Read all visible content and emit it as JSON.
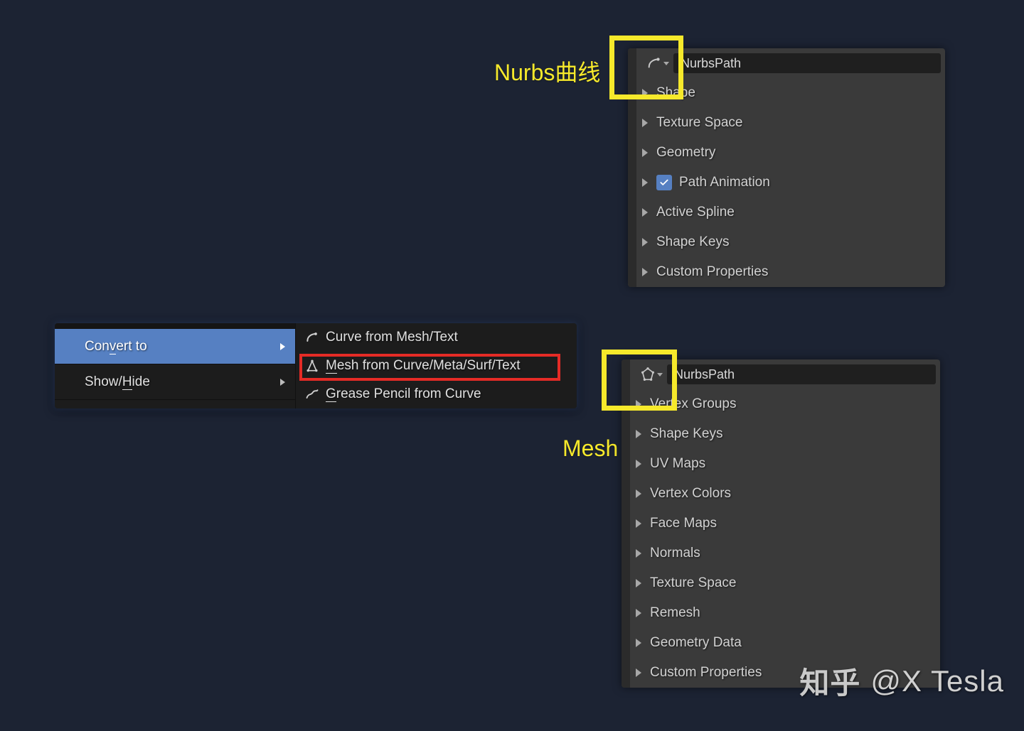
{
  "annotations": {
    "nurbs_label": "Nurbs曲线",
    "mesh_label": "Mesh"
  },
  "panel_curve": {
    "name": "NurbsPath",
    "rows": [
      "Shape",
      "Texture Space",
      "Geometry",
      "Path Animation",
      "Active Spline",
      "Shape Keys",
      "Custom Properties"
    ]
  },
  "panel_mesh": {
    "name": "NurbsPath",
    "rows": [
      "Vertex Groups",
      "Shape Keys",
      "UV Maps",
      "Vertex Colors",
      "Face Maps",
      "Normals",
      "Texture Space",
      "Remesh",
      "Geometry Data",
      "Custom Properties"
    ]
  },
  "menu": {
    "left": {
      "convert_pre": "Con",
      "convert_u": "v",
      "convert_post": "ert to",
      "show_pre": "Show/",
      "show_u": "H",
      "show_post": "ide"
    },
    "right": {
      "curve": "Curve from Mesh/Text",
      "mesh_pre": "",
      "mesh_u": "M",
      "mesh_post": "esh from Curve/Meta/Surf/Text",
      "gp_pre": "",
      "gp_u": "G",
      "gp_post": "rease Pencil from Curve"
    }
  },
  "watermark": {
    "site": "知乎",
    "user": "@X Tesla"
  }
}
